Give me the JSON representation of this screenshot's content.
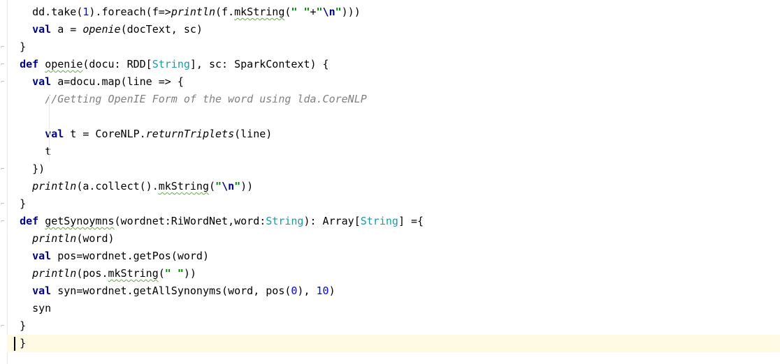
{
  "editor": {
    "lines": [
      {
        "indent": "  ",
        "tokens": [
          {
            "t": "dd.take("
          },
          {
            "t": "1",
            "c": "num"
          },
          {
            "t": ").foreach(f=>"
          },
          {
            "t": "println",
            "c": "it"
          },
          {
            "t": "(f."
          },
          {
            "t": "mkString",
            "c": "uline"
          },
          {
            "t": "("
          },
          {
            "t": "\" \"",
            "c": "str"
          },
          {
            "t": "+"
          },
          {
            "t": "\"",
            "c": "str"
          },
          {
            "t": "\\n",
            "c": "esc"
          },
          {
            "t": "\"",
            "c": "str"
          },
          {
            "t": ")))"
          }
        ]
      },
      {
        "indent": "  ",
        "tokens": [
          {
            "t": "val",
            "c": "kw"
          },
          {
            "t": " a = "
          },
          {
            "t": "openie",
            "c": "it"
          },
          {
            "t": "(docText, sc)"
          }
        ]
      },
      {
        "indent": "",
        "tokens": [
          {
            "t": "}"
          }
        ]
      },
      {
        "indent": "",
        "tokens": [
          {
            "t": "def",
            "c": "kw"
          },
          {
            "t": " "
          },
          {
            "t": "openie",
            "c": "uline"
          },
          {
            "t": "(docu: RDD["
          },
          {
            "t": "String",
            "c": "type"
          },
          {
            "t": "], sc: SparkContext) {"
          }
        ]
      },
      {
        "indent": "  ",
        "tokens": [
          {
            "t": "val",
            "c": "kw"
          },
          {
            "t": " a=docu.map(line => {"
          }
        ]
      },
      {
        "indent": "    ",
        "tokens": [
          {
            "t": "//Getting OpenIE Form of the word using lda.CoreNLP",
            "c": "cmt"
          }
        ]
      },
      {
        "indent": "",
        "tokens": []
      },
      {
        "indent": "    ",
        "tokens": [
          {
            "t": "val",
            "c": "kw"
          },
          {
            "t": " t = CoreNLP."
          },
          {
            "t": "returnTriplets",
            "c": "it"
          },
          {
            "t": "(line)"
          }
        ]
      },
      {
        "indent": "    ",
        "tokens": [
          {
            "t": "t"
          }
        ]
      },
      {
        "indent": "  ",
        "tokens": [
          {
            "t": "})"
          }
        ]
      },
      {
        "indent": "  ",
        "tokens": [
          {
            "t": "println",
            "c": "it"
          },
          {
            "t": "(a.collect()."
          },
          {
            "t": "mkString",
            "c": "uline"
          },
          {
            "t": "("
          },
          {
            "t": "\"",
            "c": "str"
          },
          {
            "t": "\\n",
            "c": "esc"
          },
          {
            "t": "\"",
            "c": "str"
          },
          {
            "t": "))"
          }
        ]
      },
      {
        "indent": "",
        "tokens": [
          {
            "t": "}"
          }
        ]
      },
      {
        "indent": "",
        "tokens": [
          {
            "t": "def",
            "c": "kw"
          },
          {
            "t": " "
          },
          {
            "t": "getSynoymns",
            "c": "uline"
          },
          {
            "t": "(wordnet:RiWordNet,word:"
          },
          {
            "t": "String",
            "c": "type"
          },
          {
            "t": "): Array["
          },
          {
            "t": "String",
            "c": "type"
          },
          {
            "t": "] ={"
          }
        ]
      },
      {
        "indent": "  ",
        "tokens": [
          {
            "t": "println",
            "c": "it"
          },
          {
            "t": "(word)"
          }
        ]
      },
      {
        "indent": "  ",
        "tokens": [
          {
            "t": "val",
            "c": "kw"
          },
          {
            "t": " pos=wordnet.getPos(word)"
          }
        ]
      },
      {
        "indent": "  ",
        "tokens": [
          {
            "t": "println",
            "c": "it"
          },
          {
            "t": "(pos."
          },
          {
            "t": "mkString",
            "c": "uline"
          },
          {
            "t": "("
          },
          {
            "t": "\" \"",
            "c": "str"
          },
          {
            "t": "))"
          }
        ]
      },
      {
        "indent": "  ",
        "tokens": [
          {
            "t": "val",
            "c": "kw"
          },
          {
            "t": " syn=wordnet.getAllSynonyms(word, pos("
          },
          {
            "t": "0",
            "c": "num"
          },
          {
            "t": "), "
          },
          {
            "t": "10",
            "c": "num"
          },
          {
            "t": ")"
          }
        ]
      },
      {
        "indent": "  ",
        "tokens": [
          {
            "t": "syn"
          }
        ]
      },
      {
        "indent": "",
        "tokens": [
          {
            "t": "}"
          }
        ]
      },
      {
        "indent": "",
        "tokens": [
          {
            "t": "}"
          }
        ],
        "current": true
      }
    ]
  }
}
